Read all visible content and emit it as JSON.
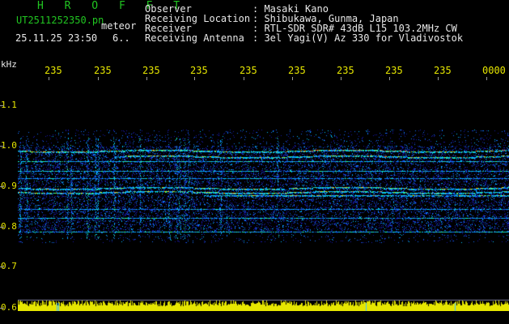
{
  "header": {
    "app_title": "H R O F F T",
    "filename": "UT2511252350.pn",
    "mode": "meteor",
    "datetime": "25.11.25 23:50",
    "extra": "6..",
    "fields": [
      {
        "label": "Observer",
        "value": ": Masaki Kano"
      },
      {
        "label": "Receiving Location",
        "value": ": Shibukawa, Gunma, Japan"
      },
      {
        "label": "Receiver",
        "value": ": RTL-SDR SDR# 43dB L15 103.2MHz CW"
      },
      {
        "label": "Receiving Antenna",
        "value": ": 3el Yagi(V) Az 330 for Vladivostok"
      }
    ]
  },
  "axis": {
    "y_unit": "kHz",
    "y_labels": [
      "1.1",
      "1.0",
      "0.9",
      "0.8",
      "0.7",
      "0.6"
    ],
    "x_labels": [
      "235",
      "235",
      "235",
      "235",
      "235",
      "235",
      "235",
      "235",
      "235",
      "0000"
    ]
  },
  "colors": {
    "background": "#000000",
    "label_green": "#21c521",
    "label_yellow": "#e6e600",
    "spectrum_low": "#0a0a8a",
    "spectrum_mid": "#00b4ff",
    "spectrum_high": "#ff3a2a"
  }
}
